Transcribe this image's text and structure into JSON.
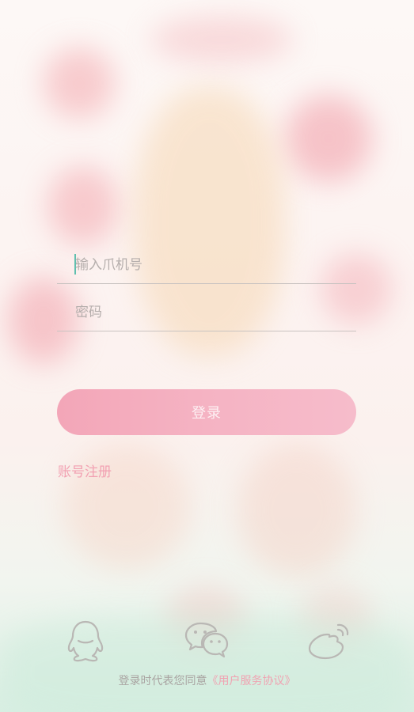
{
  "form": {
    "phone_placeholder": "输入爪机号",
    "password_placeholder": "密码",
    "login_label": "登录",
    "register_label": "账号注册"
  },
  "social": {
    "icons": [
      "qq-icon",
      "wechat-icon",
      "weibo-icon"
    ]
  },
  "agreement": {
    "prefix": "登录时代表您同意",
    "link_label": "《用户服务协议》"
  },
  "colors": {
    "accent": "#f3a6b8",
    "link": "#f0a3b2",
    "caret": "#5fbfae"
  }
}
